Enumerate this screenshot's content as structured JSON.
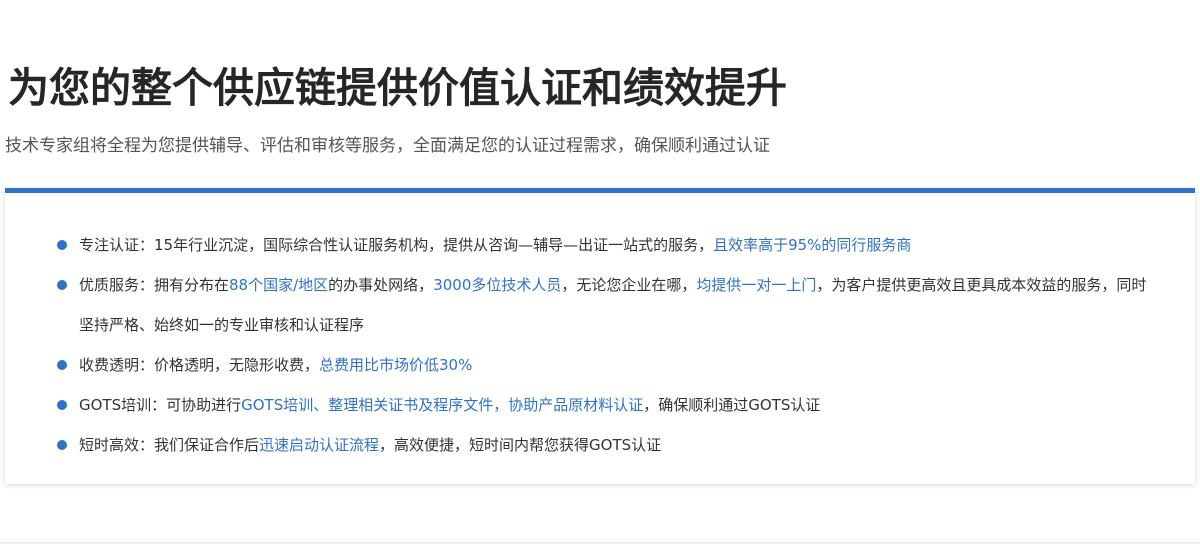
{
  "header": {
    "title": "为您的整个供应链提供价值认证和绩效提升",
    "subtitle": "技术专家组将全程为您提供辅导、评估和审核等服务，全面满足您的认证过程需求，确保顺利通过认证"
  },
  "features": [
    {
      "parts": [
        {
          "text": "专注认证：15年行业沉淀，国际综合性认证服务机构，提供从咨询—辅导—出证一站式的服务，",
          "highlight": false
        },
        {
          "text": "且效率高于95%的同行服务商",
          "highlight": true
        }
      ]
    },
    {
      "parts": [
        {
          "text": "优质服务：拥有分布在",
          "highlight": false
        },
        {
          "text": "88个国家/地区",
          "highlight": true
        },
        {
          "text": "的办事处网络，",
          "highlight": false
        },
        {
          "text": "3000多位技术人员",
          "highlight": true
        },
        {
          "text": "，无论您企业在哪，",
          "highlight": false
        },
        {
          "text": "均提供一对一上门",
          "highlight": true
        },
        {
          "text": "，为客户提供更高效且更具成本效益的服务，同时坚持严格、始终如一的专业审核和认证程序",
          "highlight": false
        }
      ]
    },
    {
      "parts": [
        {
          "text": "收费透明：价格透明，无隐形收费，",
          "highlight": false
        },
        {
          "text": "总费用比市场价低30%",
          "highlight": true
        }
      ]
    },
    {
      "parts": [
        {
          "text": "GOTS培训：可协助进行",
          "highlight": false
        },
        {
          "text": "GOTS培训、整理相关证书及程序文件，协助产品原材料认证",
          "highlight": true
        },
        {
          "text": "，确保顺利通过GOTS认证",
          "highlight": false
        }
      ]
    },
    {
      "parts": [
        {
          "text": "短时高效：我们保证合作后",
          "highlight": false
        },
        {
          "text": "迅速启动认证流程",
          "highlight": true
        },
        {
          "text": "，高效便捷，短时间内帮您获得GOTS认证",
          "highlight": false
        }
      ]
    }
  ],
  "colors": {
    "accent": "#2f72c9",
    "title": "#262626",
    "body_text": "#333333",
    "subtitle_text": "#555555"
  }
}
